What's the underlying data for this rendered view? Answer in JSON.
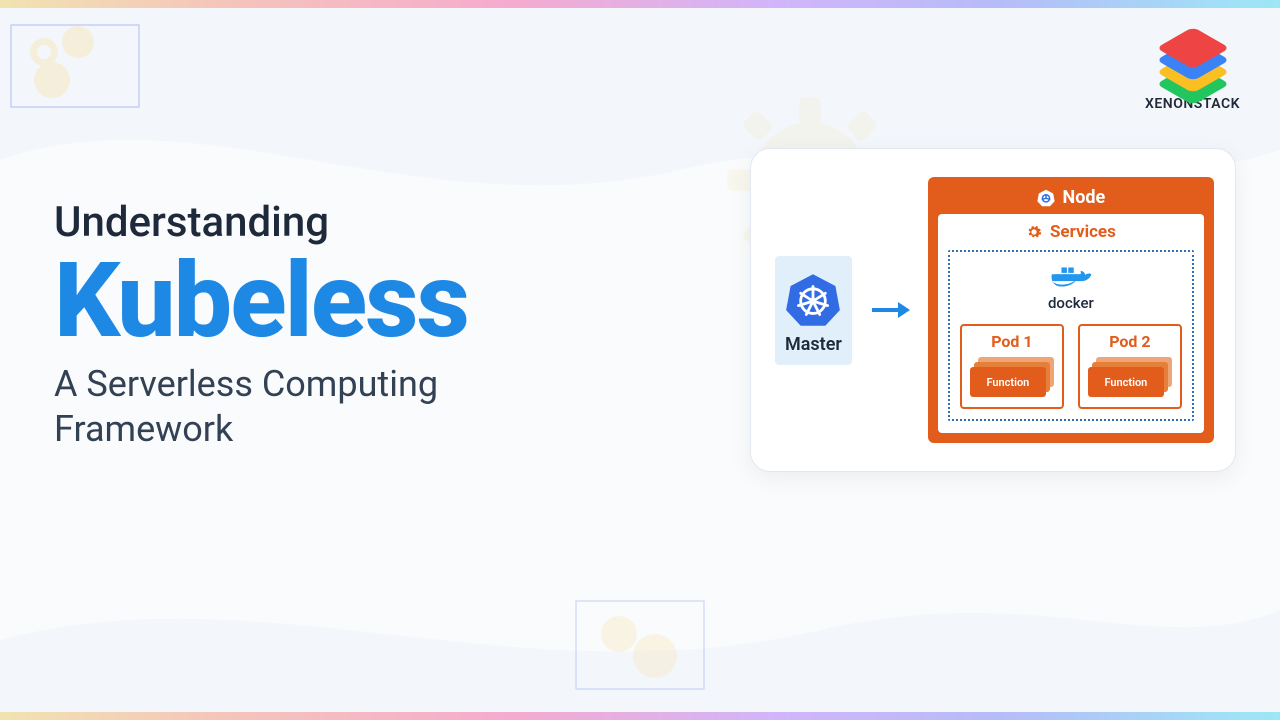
{
  "brand": {
    "name": "XENONSTACK"
  },
  "hero": {
    "line1": "Understanding",
    "line2": "Kubeless",
    "line3a": "A Serverless Computing",
    "line3b": "Framework"
  },
  "diagram": {
    "master_label": "Master",
    "node_label": "Node",
    "services_label": "Services",
    "docker_label": "docker",
    "pods": [
      {
        "title": "Pod 1",
        "fn": "Function"
      },
      {
        "title": "Pod 2",
        "fn": "Function"
      }
    ]
  },
  "colors": {
    "accent_blue": "#1e88e5",
    "accent_orange": "#e25d1b",
    "card_bg": "#ffffff",
    "master_bg": "#e1effa"
  }
}
